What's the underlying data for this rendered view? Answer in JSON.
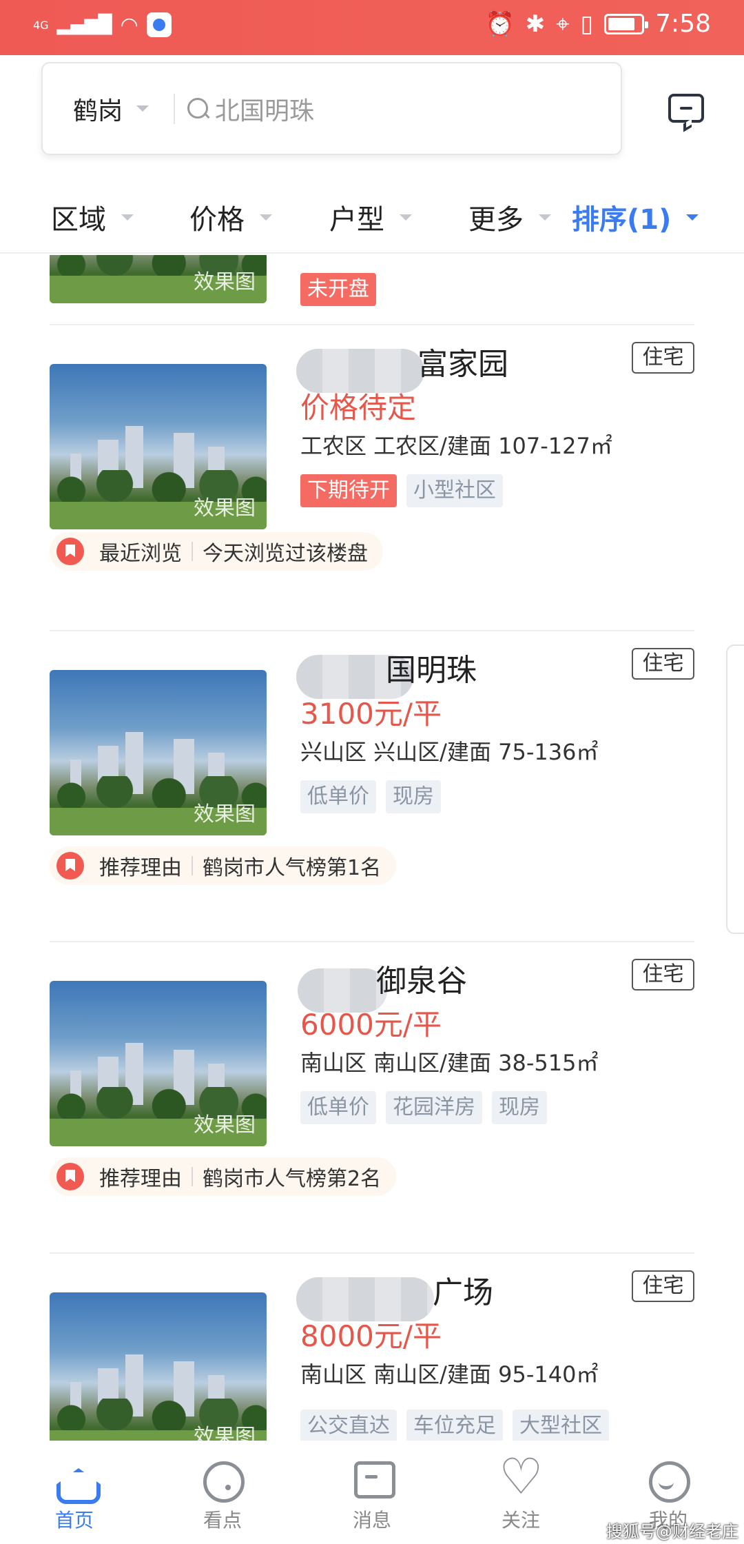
{
  "status_bar": {
    "network": "4G",
    "time": "7:58"
  },
  "search": {
    "city": "鹤岗",
    "placeholder": "北国明珠"
  },
  "filters": [
    "区域",
    "价格",
    "户型",
    "更多",
    "排序(1)"
  ],
  "top_partial": {
    "watermark": "效果图",
    "tag": "未开盘"
  },
  "listings": [
    {
      "name_visible": "富家园",
      "type": "住宅",
      "price": "价格待定",
      "address": "工农区 工农区/建面 107-127㎡",
      "tags": [
        "下期待开",
        "小型社区"
      ],
      "reason_label": "最近浏览",
      "reason_text": "今天浏览过该楼盘",
      "watermark": "效果图"
    },
    {
      "name_visible": "国明珠",
      "type": "住宅",
      "price": "3100元/平",
      "address": "兴山区 兴山区/建面 75-136㎡",
      "tags": [
        "低单价",
        "现房"
      ],
      "reason_label": "推荐理由",
      "reason_text": "鹤岗市人气榜第1名",
      "watermark": "效果图"
    },
    {
      "name_visible": "御泉谷",
      "type": "住宅",
      "price": "6000元/平",
      "address": "南山区 南山区/建面 38-515㎡",
      "tags": [
        "低单价",
        "花园洋房",
        "现房"
      ],
      "reason_label": "推荐理由",
      "reason_text": "鹤岗市人气榜第2名",
      "watermark": "效果图"
    },
    {
      "name_visible": "广场",
      "type": "住宅",
      "price": "8000元/平",
      "address": "南山区 南山区/建面 95-140㎡",
      "tags": [
        "公交直达",
        "车位充足",
        "大型社区"
      ],
      "watermark": "效果图"
    }
  ],
  "tabbar": [
    "首页",
    "看点",
    "消息",
    "关注",
    "我的"
  ],
  "watermark": "搜狐号@财经老庄"
}
